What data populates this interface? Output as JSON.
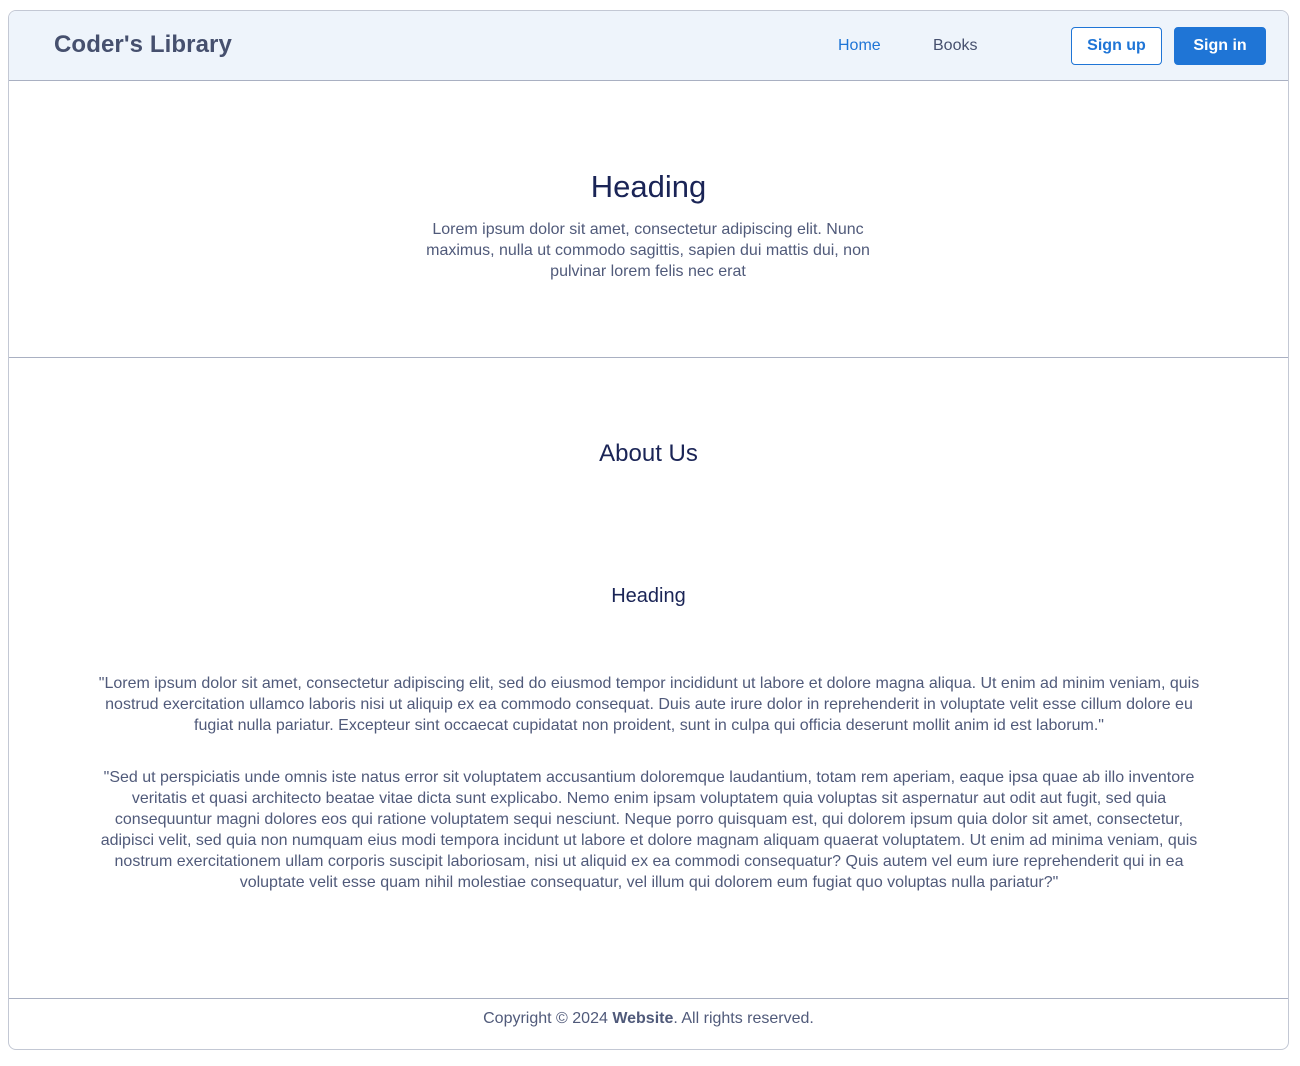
{
  "navbar": {
    "brand": "Coder's Library",
    "links": [
      {
        "label": "Home",
        "active": true
      },
      {
        "label": "Books",
        "active": false
      }
    ],
    "signup_label": "Sign up",
    "signin_label": "Sign in"
  },
  "hero": {
    "title": "Heading",
    "text": "Lorem ipsum dolor sit amet, consectetur adipiscing elit. Nunc maximus, nulla ut commodo sagittis, sapien dui mattis dui, non pulvinar lorem felis nec erat"
  },
  "about": {
    "title": "About Us",
    "subtitle": "Heading",
    "paragraph1": "\"Lorem ipsum dolor sit amet, consectetur adipiscing elit, sed do eiusmod tempor incididunt ut labore et dolore magna aliqua. Ut enim ad minim veniam, quis nostrud exercitation ullamco laboris nisi ut aliquip ex ea commodo consequat. Duis aute irure dolor in reprehenderit in voluptate velit esse cillum dolore eu fugiat nulla pariatur. Excepteur sint occaecat cupidatat non proident, sunt in culpa qui officia deserunt mollit anim id est laborum.\"",
    "paragraph2": "\"Sed ut perspiciatis unde omnis iste natus error sit voluptatem accusantium doloremque laudantium, totam rem aperiam, eaque ipsa quae ab illo inventore veritatis et quasi architecto beatae vitae dicta sunt explicabo. Nemo enim ipsam voluptatem quia voluptas sit aspernatur aut odit aut fugit, sed quia consequuntur magni dolores eos qui ratione voluptatem sequi nesciunt. Neque porro quisquam est, qui dolorem ipsum quia dolor sit amet, consectetur, adipisci velit, sed quia non numquam eius modi tempora incidunt ut labore et dolore magnam aliquam quaerat voluptatem. Ut enim ad minima veniam, quis nostrum exercitationem ullam corporis suscipit laboriosam, nisi ut aliquid ex ea commodi consequatur? Quis autem vel eum iure reprehenderit qui in ea voluptate velit esse quam nihil molestiae consequatur, vel illum qui dolorem eum fugiat quo voluptas nulla pariatur?\""
  },
  "footer": {
    "prefix": "Copyright © 2024 ",
    "site": "Website",
    "suffix": ". All rights reserved."
  },
  "colors": {
    "accent": "#1f75d6",
    "navbar_bg": "#eef4fb",
    "heading": "#1a2456",
    "body_text": "#505a7a"
  }
}
